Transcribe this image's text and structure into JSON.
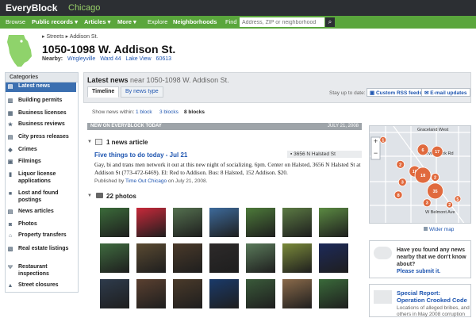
{
  "brand": {
    "logo": "EveryBlock",
    "city": "Chicago"
  },
  "nav": {
    "items": [
      {
        "label": "Browse",
        "dropdown": false
      },
      {
        "label": "Public records",
        "dropdown": true
      },
      {
        "label": "Articles",
        "dropdown": true
      },
      {
        "label": "More",
        "dropdown": true
      },
      {
        "label": "Explore",
        "dropdown": false
      },
      {
        "label": "Neighborhoods",
        "dropdown": false
      },
      {
        "label": "Find",
        "dropdown": false
      }
    ],
    "search_placeholder": "Address, ZIP or neighborhood"
  },
  "location": {
    "breadcrumbs": [
      "Streets",
      "Addison St."
    ],
    "address": "1050-1098 W. Addison St.",
    "nearby_label": "Nearby:",
    "nearby": [
      "Wrigleyville",
      "Ward 44",
      "Lake View",
      "60613"
    ]
  },
  "categories": {
    "heading": "Categories",
    "items": [
      {
        "label": "Latest news",
        "icon": "news-icon",
        "selected": true
      },
      {
        "label": "Building permits",
        "icon": "building-icon",
        "selected": false
      },
      {
        "label": "Business licenses",
        "icon": "license-icon",
        "selected": false
      },
      {
        "label": "Business reviews",
        "icon": "star-icon",
        "selected": false
      },
      {
        "label": "City press releases",
        "icon": "document-icon",
        "selected": false
      },
      {
        "label": "Crimes",
        "icon": "badge-icon",
        "selected": false
      },
      {
        "label": "Filmings",
        "icon": "film-icon",
        "selected": false
      },
      {
        "label": "Liquor license applications",
        "icon": "bottle-icon",
        "selected": false
      },
      {
        "label": "Lost and found postings",
        "icon": "box-icon",
        "selected": false
      },
      {
        "label": "News articles",
        "icon": "newspaper-icon",
        "selected": false
      },
      {
        "label": "Photos",
        "icon": "camera-icon",
        "selected": false
      },
      {
        "label": "Property transfers",
        "icon": "house-icon",
        "selected": false
      },
      {
        "label": "Real estate listings",
        "icon": "sign-icon",
        "selected": false
      },
      {
        "label": "Restaurant inspections",
        "icon": "fork-icon",
        "selected": false
      },
      {
        "label": "Street closures",
        "icon": "cone-icon",
        "selected": false
      }
    ]
  },
  "main": {
    "title": "Latest news",
    "title_suffix": "near 1050-1098 W. Addison St.",
    "tabs": [
      "Timeline",
      "By news type"
    ],
    "stay_up_to_date": "Stay up to date:",
    "rss_label": "Custom RSS feeds",
    "email_label": "E-mail updates",
    "show_within": "Show news within:",
    "radius_options": [
      "1 block",
      "3 blocks",
      "8 blocks"
    ],
    "selected_radius": "8 blocks"
  },
  "feed": {
    "section_label": "NEW ON EVERYBLOCK TODAY",
    "section_date": "JULY 21, 2008",
    "news_header": "1 news article",
    "article": {
      "title": "Five things to do today - Jul 21",
      "location": "3656 N Halsted St",
      "body": "Gay, bi and trans men network it out at this new night of socializing. 6pm. Center on Halsted, 3656 N Halsted St at Addison St (773-472-6469). El: Red to Addison. Bus: 8 Halsted, 152 Addison. $20.",
      "published_prefix": "Published by",
      "publisher": "Time Out Chicago",
      "published_suffix": "on July 21, 2008."
    },
    "photos_header": "22 photos",
    "photos": [
      {
        "subject": "baseball-field",
        "color": "#3b6b3a"
      },
      {
        "subject": "hot-dog-cup",
        "color": "#c8293a"
      },
      {
        "subject": "ballpark-scoreboard",
        "color": "#54704f"
      },
      {
        "subject": "batter",
        "color": "#3d6a9b"
      },
      {
        "subject": "pitcher",
        "color": "#4d7a3a"
      },
      {
        "subject": "pitcher",
        "color": "#5b7a43"
      },
      {
        "subject": "wrigley-field",
        "color": "#5b8a42"
      },
      {
        "subject": "stadium-crowd",
        "color": "#3f6b3f"
      },
      {
        "subject": "manhole-cover",
        "color": "#5a4a32"
      },
      {
        "subject": "fans-in-stands",
        "color": "#4a3a2a"
      },
      {
        "subject": "dark-scene",
        "color": "#2d2a2a"
      },
      {
        "subject": "ballpark-stands",
        "color": "#5a7a5a"
      },
      {
        "subject": "infield",
        "color": "#7a8a3a"
      },
      {
        "subject": "phone-screen",
        "color": "#1d2a5a"
      },
      {
        "subject": "night-street",
        "color": "#2e3b4c"
      },
      {
        "subject": "car-interior",
        "color": "#5a4030"
      },
      {
        "subject": "restaurant-interior",
        "color": "#4a3a2a"
      },
      {
        "subject": "target-logo",
        "color": "#1a3a6a"
      },
      {
        "subject": "scoreboard",
        "color": "#3a5a3a"
      },
      {
        "subject": "face-portrait",
        "color": "#8a6a4a"
      },
      {
        "subject": "baseball-play",
        "color": "#3a6a3a"
      }
    ]
  },
  "map": {
    "labels": [
      "Graceland West",
      "W Irving Park Rd",
      "W Belmont Ave"
    ],
    "markers": [
      {
        "count": "1",
        "lx": 0.13,
        "ly": 0.14,
        "r": 4
      },
      {
        "count": "6",
        "lx": 0.52,
        "ly": 0.24,
        "r": 7
      },
      {
        "count": "17",
        "lx": 0.66,
        "ly": 0.26,
        "r": 7
      },
      {
        "count": "2",
        "lx": 0.3,
        "ly": 0.39,
        "r": 5
      },
      {
        "count": "10",
        "lx": 0.44,
        "ly": 0.46,
        "r": 7
      },
      {
        "count": "18",
        "lx": 0.52,
        "ly": 0.5,
        "r": 10
      },
      {
        "count": "3",
        "lx": 0.32,
        "ly": 0.57,
        "r": 5
      },
      {
        "count": "2",
        "lx": 0.64,
        "ly": 0.52,
        "r": 5
      },
      {
        "count": "35",
        "lx": 0.64,
        "ly": 0.66,
        "r": 10
      },
      {
        "count": "8",
        "lx": 0.28,
        "ly": 0.7,
        "r": 5
      },
      {
        "count": "3",
        "lx": 0.56,
        "ly": 0.78,
        "r": 5
      },
      {
        "count": "5",
        "lx": 0.86,
        "ly": 0.74,
        "r": 4
      },
      {
        "count": "2",
        "lx": 0.78,
        "ly": 0.8,
        "r": 4
      }
    ],
    "wider_label": "Wider map"
  },
  "ask": {
    "question": "Have you found any news nearby that we don't know about?",
    "link": "Please submit it."
  },
  "special": {
    "title": "Special Report: Operation Crooked Code",
    "description": "Locations of alleged bribes, and others in May 2008 corruption"
  },
  "colors": {
    "topbar": "#2c2f33",
    "navbar": "#5aa63c",
    "accent": "#1e55b0",
    "marker": "#e06a3e",
    "category_selected": "#3b6fb0"
  }
}
